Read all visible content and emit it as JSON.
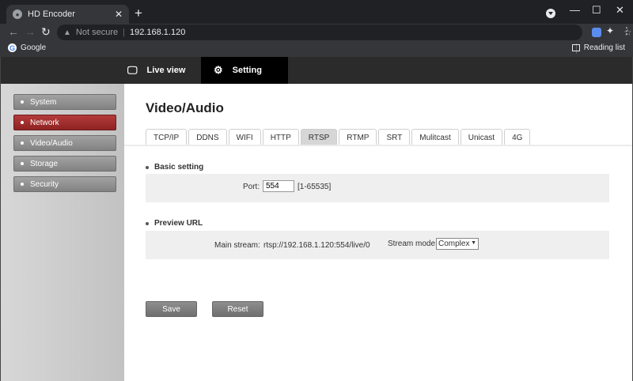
{
  "browser": {
    "tab_title": "HD Encoder",
    "tab_close": "✕",
    "new_tab": "+",
    "security_label": "Not secure",
    "url": "192.168.1.120",
    "bookmarks": [
      {
        "label": "Google"
      }
    ],
    "reading_list": "Reading list",
    "window_controls": {
      "minimize": "—",
      "maximize": "☐",
      "close": "✕"
    }
  },
  "topnav": {
    "live_view": "Live view",
    "setting": "Setting"
  },
  "sidebar": {
    "items": [
      {
        "label": "System",
        "active": false
      },
      {
        "label": "Network",
        "active": true
      },
      {
        "label": "Video/Audio",
        "active": false
      },
      {
        "label": "Storage",
        "active": false
      },
      {
        "label": "Security",
        "active": false
      }
    ]
  },
  "main": {
    "title": "Video/Audio",
    "tabs": [
      {
        "label": "TCP/IP"
      },
      {
        "label": "DDNS"
      },
      {
        "label": "WIFI"
      },
      {
        "label": "HTTP"
      },
      {
        "label": "RTSP",
        "active": true
      },
      {
        "label": "RTMP"
      },
      {
        "label": "SRT"
      },
      {
        "label": "Mulitcast"
      },
      {
        "label": "Unicast"
      },
      {
        "label": "4G"
      }
    ],
    "basic": {
      "title": "Basic setting",
      "port_label": "Port:",
      "port_value": "554",
      "port_range": "[1-65535]"
    },
    "preview": {
      "title": "Preview URL",
      "main_stream_label": "Main stream:",
      "main_stream_url": "rtsp://192.168.1.120:554/live/0",
      "stream_mode_label": "Stream mode",
      "stream_mode_value": "Complex"
    },
    "buttons": {
      "save": "Save",
      "reset": "Reset"
    }
  }
}
